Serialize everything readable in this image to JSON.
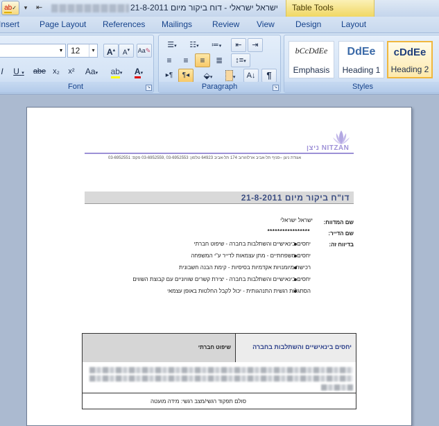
{
  "titlebar": {
    "qat_icon": "spelling-abc-icon",
    "window_title": "ישראל ישראלי - דוח ביקור מיום 21-8-2011",
    "table_tools_label": "Table Tools"
  },
  "tabs": {
    "insert": "Insert",
    "page_layout": "Page Layout",
    "references": "References",
    "mailings": "Mailings",
    "review": "Review",
    "view": "View",
    "design": "Design",
    "layout": "Layout"
  },
  "ribbon": {
    "font_group_label": "Font",
    "paragraph_group_label": "Paragraph",
    "styles_group_label": "Styles",
    "font_size": "12",
    "font_buttons": {
      "grow": "A",
      "shrink": "A",
      "underline": "U",
      "strikethrough": "abe",
      "subscript": "x₂",
      "superscript": "x²",
      "change_case": "Aa",
      "font_color": "A"
    },
    "styles": [
      {
        "sample": "bCcDdEe",
        "name": "Emphasis"
      },
      {
        "sample": "DdEe",
        "name": "Heading 1"
      },
      {
        "sample": "cDdEe",
        "name": "Heading 2"
      }
    ],
    "accent_color": "#f0b73d",
    "ribbon_color": "#d5e4f6"
  },
  "document": {
    "logo_text": "ניצן NITZAN",
    "address_line": "אגודת ניצן –סניף תל-אביב  ארלוזורוב 174 תל-אביב 64923  טלפון: 03-6952553 ,03-6952559  פקס: 03-6952551",
    "report_title": "דו\"ח ביקור מיום 21-8-2011",
    "fields": {
      "name_label": "שם המדווח:",
      "name_value": "ישראל ישראלי",
      "resident_label": "שם הדייר:",
      "resident_value": "*****************",
      "report_label": "בדיווח זה:"
    },
    "bullets": [
      "יחסים בינאישיים והשתלבות בחברה - שיפוט חברתי",
      "יחסים משפחתיים - מתן עצמאות לדייר ע\"י המשפחה",
      "רכישת מיומנויות אקדמיות בסיסיות - קימת הבנה חשבונית",
      "יחסים בינאישיים והשתלבות בחברה - יצירת קשרים שוויוניים עם קבוצת השווים",
      "הסתגלות רגשית התנהגותית - יכול לקבל החלטות באופן עצמאי"
    ],
    "table": {
      "header_right": "יחסים בינאישיים והשתלבות בחברה",
      "header_left": "שיפוט חברתי",
      "footer_row": "סולם תפקוד רגשי/מצב רגשי: מידה מועטה"
    }
  }
}
